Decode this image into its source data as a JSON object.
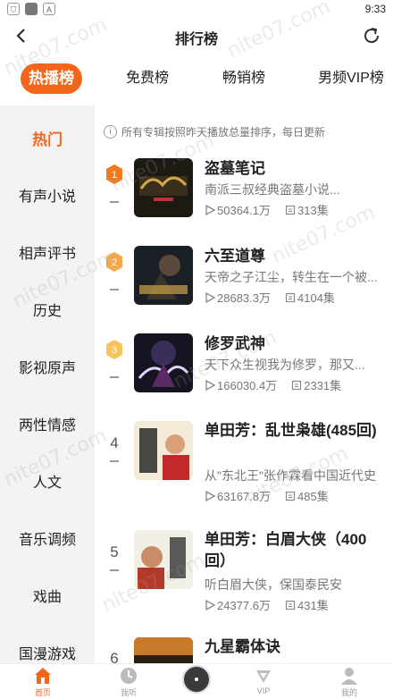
{
  "status_bar": {
    "time": "9:33",
    "icons": [
      "shield-icon",
      "square-icon",
      "a-icon"
    ]
  },
  "nav": {
    "title": "排行榜"
  },
  "tabs": [
    {
      "label": "热播榜",
      "active": true
    },
    {
      "label": "免费榜",
      "active": false
    },
    {
      "label": "畅销榜",
      "active": false
    },
    {
      "label": "男频VIP榜",
      "active": false
    }
  ],
  "sidebar": [
    {
      "label": "热门",
      "active": true
    },
    {
      "label": "有声小说"
    },
    {
      "label": "相声评书"
    },
    {
      "label": "历史"
    },
    {
      "label": "影视原声"
    },
    {
      "label": "两性情感"
    },
    {
      "label": "人文"
    },
    {
      "label": "音乐调频"
    },
    {
      "label": "戏曲"
    },
    {
      "label": "国漫游戏"
    }
  ],
  "notice": "所有专辑按照昨天播放总量排序，每日更新",
  "ranking": [
    {
      "rank": "1",
      "title": "盗墓笔记",
      "desc": "南派三叔经典盗墓小说...",
      "plays": "50364.1万",
      "episodes": "313集",
      "badge": "gold"
    },
    {
      "rank": "2",
      "title": "六至道尊",
      "desc": "天帝之子江尘，转生在一个被...",
      "plays": "28683.3万",
      "episodes": "4104集",
      "badge": "silver"
    },
    {
      "rank": "3",
      "title": "修罗武神",
      "desc": "天下众生视我为修罗，那又...",
      "plays": "166030.4万",
      "episodes": "2331集",
      "badge": "bronze"
    },
    {
      "rank": "4",
      "title": "单田芳：乱世枭雄(485回)",
      "desc": "从\"东北王\"张作霖看中国近代史",
      "plays": "63167.8万",
      "episodes": "485集"
    },
    {
      "rank": "5",
      "title": "单田芳：白眉大侠（400回）",
      "desc": "听白眉大侠，保国泰民安",
      "plays": "24377.6万",
      "episodes": "431集"
    },
    {
      "rank": "6",
      "title": "九星霸体诀"
    }
  ],
  "bottom_nav": [
    {
      "label": "首页",
      "icon": "home-icon",
      "active": true
    },
    {
      "label": "我听",
      "icon": "clock-icon"
    },
    {
      "label": "VIP",
      "icon": "vip-icon"
    },
    {
      "label": "我的",
      "icon": "user-icon"
    }
  ],
  "watermark": "nite07.com",
  "colors": {
    "accent": "#f2661b",
    "sidebar_bg": "#f3f3f3"
  }
}
